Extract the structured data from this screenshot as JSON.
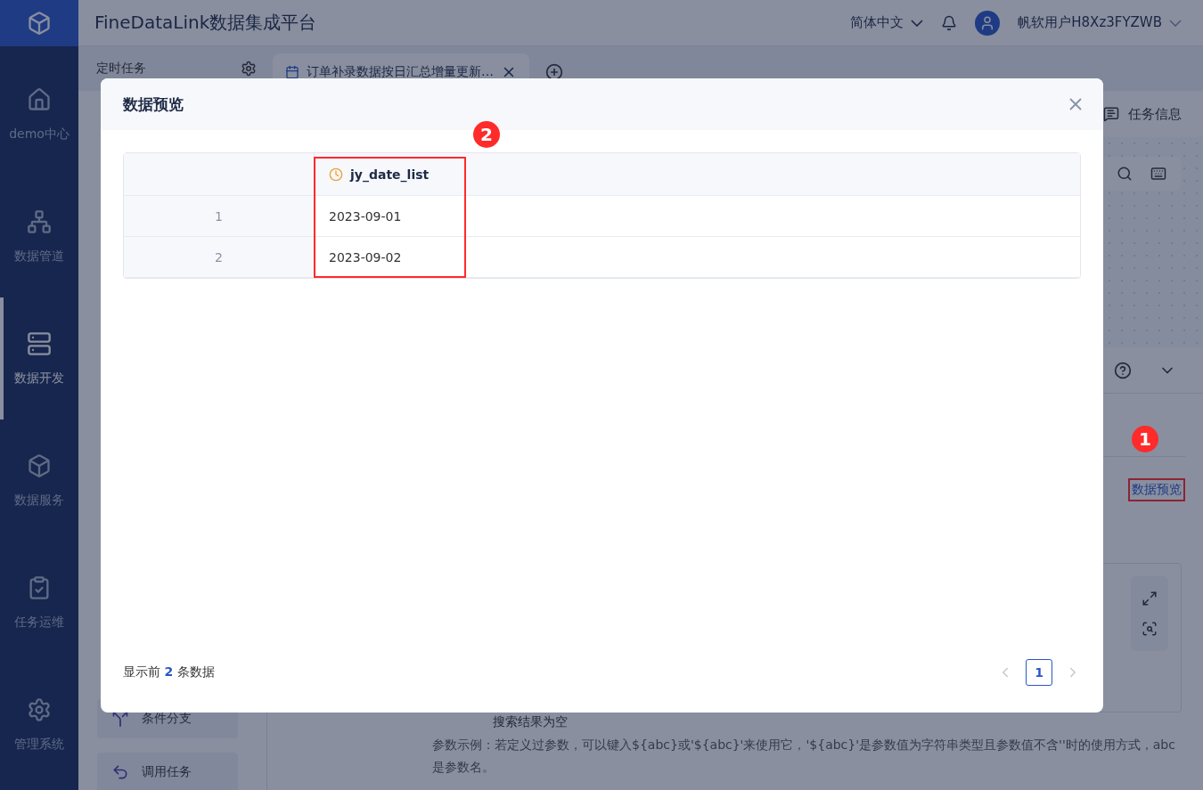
{
  "header": {
    "title": "FineDataLink数据集成平台",
    "language": "简体中文",
    "user": "帆软用户H8Xz3FYZWB"
  },
  "sidebar": {
    "items": [
      {
        "label": "demo中心",
        "selected": false
      },
      {
        "label": "数据管道",
        "selected": false
      },
      {
        "label": "数据开发",
        "selected": true
      },
      {
        "label": "数据服务",
        "selected": false
      },
      {
        "label": "任务运维",
        "selected": false
      },
      {
        "label": "管理系统",
        "selected": false
      }
    ]
  },
  "tab_bar": {
    "pinned": "定时任务",
    "tabs": [
      {
        "label": "订单补录数据按日汇总增量更新…",
        "selected": true
      }
    ]
  },
  "background": {
    "task_info": "任务信息",
    "data_preview_link": "数据预览",
    "empty_result": "搜索结果为空",
    "hint": "参数示例：若定义过参数，可以键入${abc}或'${abc}'来使用它，'${abc}'是参数值为字符串类型且参数值不含''时的使用方式，abc是参数名。",
    "node_buttons": [
      "条件分支",
      "调用任务"
    ]
  },
  "annotations": [
    {
      "label": "1"
    },
    {
      "label": "2"
    }
  ],
  "dialog": {
    "title": "数据预览",
    "columns": [
      {
        "name": "jy_date_list",
        "kind": "date"
      }
    ],
    "rows": [
      {
        "index": "1",
        "values": [
          "2023-09-01"
        ]
      },
      {
        "index": "2",
        "values": [
          "2023-09-02"
        ]
      }
    ],
    "footer": "显示前 **2** 条数据",
    "pagination": {
      "pages": [
        {
          "label": "1",
          "selected": true
        }
      ]
    }
  }
}
